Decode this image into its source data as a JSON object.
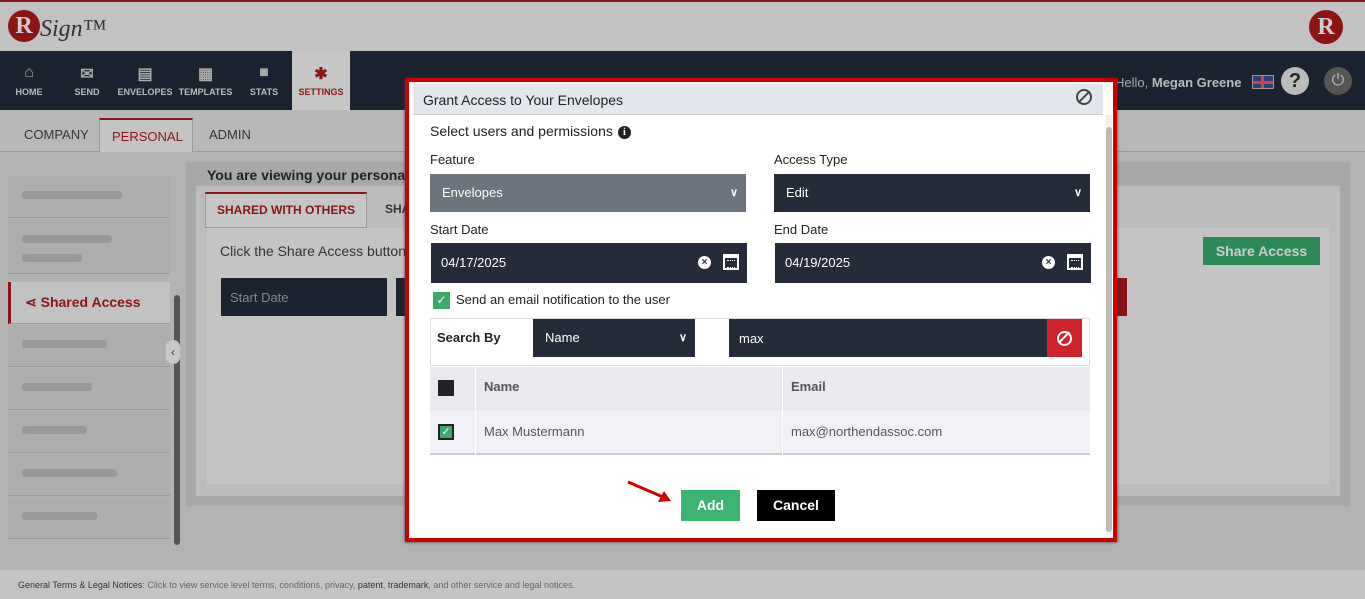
{
  "brand": {
    "logo_letter": "R",
    "logo_text": "Sign™"
  },
  "nav": {
    "items": [
      {
        "label": "HOME",
        "icon": "home-icon"
      },
      {
        "label": "SEND",
        "icon": "envelope-icon"
      },
      {
        "label": "ENVELOPES",
        "icon": "inbox-icon"
      },
      {
        "label": "TEMPLATES",
        "icon": "document-icon"
      },
      {
        "label": "STATS",
        "icon": "briefcase-icon"
      },
      {
        "label": "SETTINGS",
        "icon": "gear-icon"
      }
    ],
    "greeting_prefix": "Hello,",
    "user_name": "Megan Greene",
    "help_glyph": "?"
  },
  "subtabs": [
    "COMPANY",
    "PERSONAL",
    "ADMIN"
  ],
  "side_menu": {
    "active_label": "Shared Access"
  },
  "main": {
    "viewing_text": "You are viewing your persona",
    "tab_shared": "SHARED WITH OTHERS",
    "tab_partial": "SHA",
    "click_text": "Click the Share Access button t",
    "start_date_label": "Start Date",
    "share_access_button": "Share Access"
  },
  "footer": {
    "link_text": "General Terms & Legal Notices",
    "text": ": Click to view service level terms, conditions, privacy, ",
    "patent": "patent",
    "comma": ", ",
    "trademark": "trademark",
    "tail": ", and other service and legal notices."
  },
  "modal": {
    "title": "Grant Access to Your Envelopes",
    "subtitle": "Select users and permissions",
    "feature_label": "Feature",
    "feature_value": "Envelopes",
    "access_type_label": "Access Type",
    "access_type_value": "Edit",
    "start_date_label": "Start Date",
    "start_date_value": "04/17/2025",
    "end_date_label": "End Date",
    "end_date_value": "04/19/2025",
    "notify_label": "Send an email notification to the user",
    "search_by_label": "Search By",
    "search_by_value": "Name",
    "search_value": "max",
    "table": {
      "headers": [
        "Name",
        "Email"
      ],
      "rows": [
        {
          "name": "Max Mustermann",
          "email": "max@northendassoc.com"
        }
      ]
    },
    "add_button": "Add",
    "cancel_button": "Cancel"
  },
  "colors": {
    "brand_red": "#8b1414",
    "nav_dark": "#1b2330",
    "success_green": "#3cb371",
    "danger_red": "#d0222c"
  }
}
